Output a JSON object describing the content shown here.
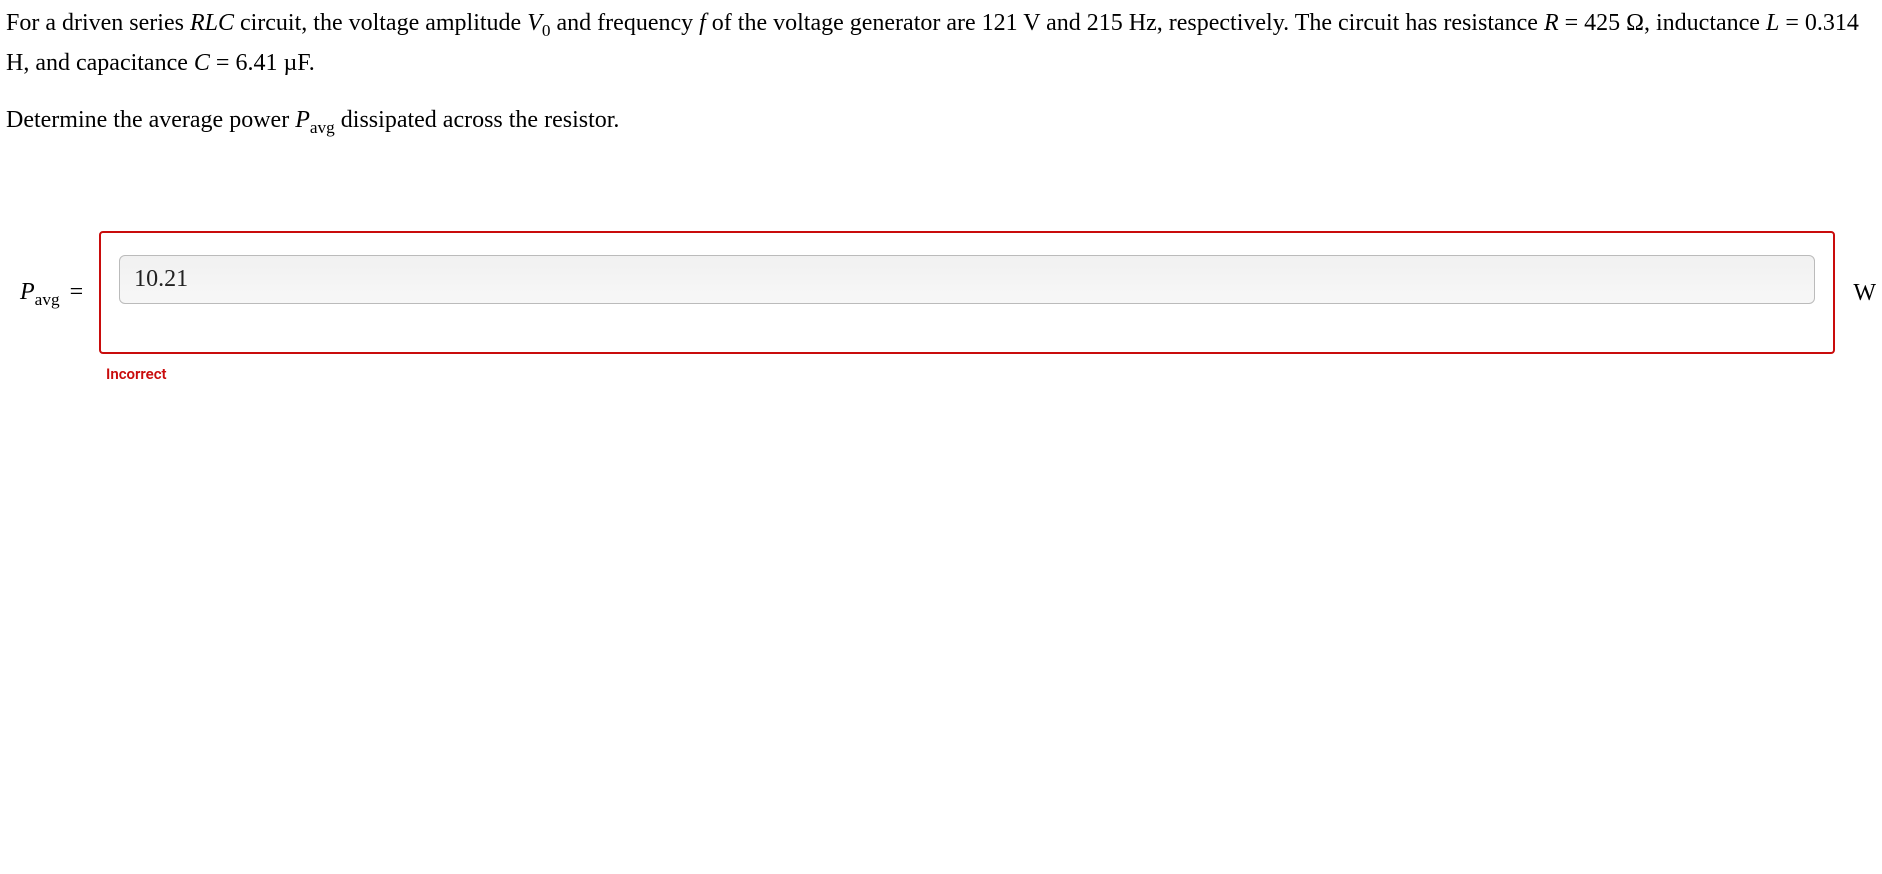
{
  "problem": {
    "line1_a": "For a driven series ",
    "line1_b": " circuit, the voltage amplitude ",
    "line1_c": " and frequency ",
    "line1_d": " of the voltage generator are 121 V and 215 Hz,",
    "line2_a": "respectively. The circuit has resistance ",
    "line2_b": " = 425 Ω, inductance ",
    "line2_c": " = 0.314 H, and capacitance ",
    "line2_d": " = 6.41 µF.",
    "var_RLC": "RLC",
    "var_V": "V",
    "var_V_sub": "0",
    "var_f": "f",
    "var_R": "R",
    "var_L": "L",
    "var_C": "C"
  },
  "prompt": {
    "a": "Determine the average power ",
    "b": " dissipated across the resistor.",
    "var_P": "P",
    "var_P_sub": "avg"
  },
  "answer": {
    "label_P": "P",
    "label_sub": "avg",
    "label_eq": " =",
    "value": "10.21",
    "unit": "W",
    "feedback": "Incorrect"
  }
}
